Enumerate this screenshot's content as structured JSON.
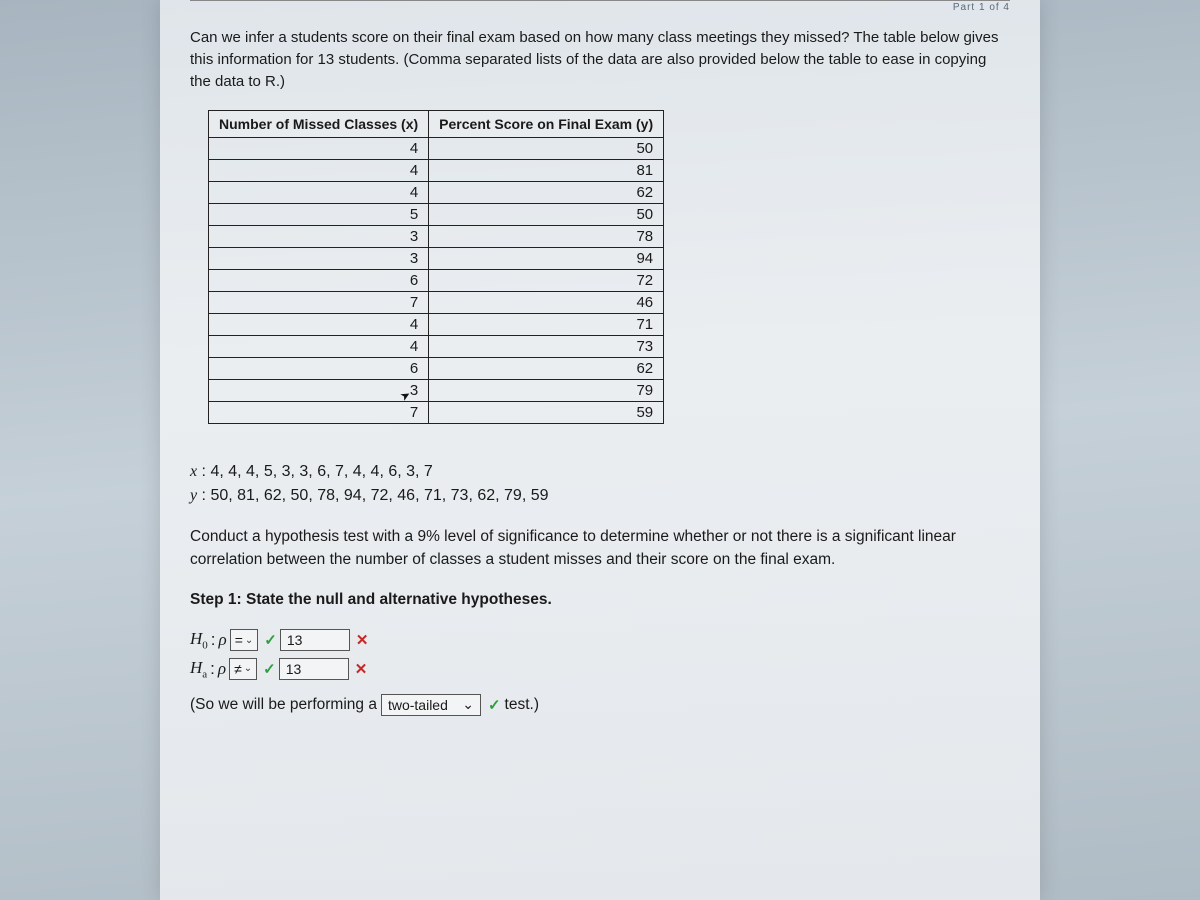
{
  "topLabel": "Part 1 of 4",
  "intro": "Can we infer a students score on their final exam based on how many class meetings they missed? The table below gives this information for 13 students. (Comma separated lists of the data are also provided below the table to ease in copying the data to R.)",
  "table": {
    "headers": [
      "Number of Missed Classes (x)",
      "Percent Score on Final Exam (y)"
    ],
    "rows": [
      [
        "4",
        "50"
      ],
      [
        "4",
        "81"
      ],
      [
        "4",
        "62"
      ],
      [
        "5",
        "50"
      ],
      [
        "3",
        "78"
      ],
      [
        "3",
        "94"
      ],
      [
        "6",
        "72"
      ],
      [
        "7",
        "46"
      ],
      [
        "4",
        "71"
      ],
      [
        "4",
        "73"
      ],
      [
        "6",
        "62"
      ],
      [
        "3",
        "79"
      ],
      [
        "7",
        "59"
      ]
    ]
  },
  "lists": {
    "x_label": "x",
    "x_values": "4, 4, 4, 5, 3, 3, 6, 7, 4, 4, 6, 3, 7",
    "y_label": "y",
    "y_values": "50, 81, 62, 50, 78, 94, 72, 46, 71, 73, 62, 79, 59"
  },
  "instruction": "Conduct a hypothesis test with a 9% level of significance to determine whether or not there is a significant linear correlation between the number of classes a student misses and their score on the final exam.",
  "step1": "Step 1: State the null and alternative hypotheses.",
  "h0": {
    "label_pre": "H",
    "label_sub": "0",
    "colon": ":",
    "rho": "ρ",
    "select": "=",
    "input": "13"
  },
  "ha": {
    "label_pre": "H",
    "label_sub": "a",
    "colon": ":",
    "rho": "ρ",
    "select": "≠",
    "input": "13"
  },
  "final": {
    "pre": "(So we will be performing a",
    "select": "two-tailed",
    "post": "test.)"
  },
  "marks": {
    "check": "✓",
    "cross": "✕"
  }
}
